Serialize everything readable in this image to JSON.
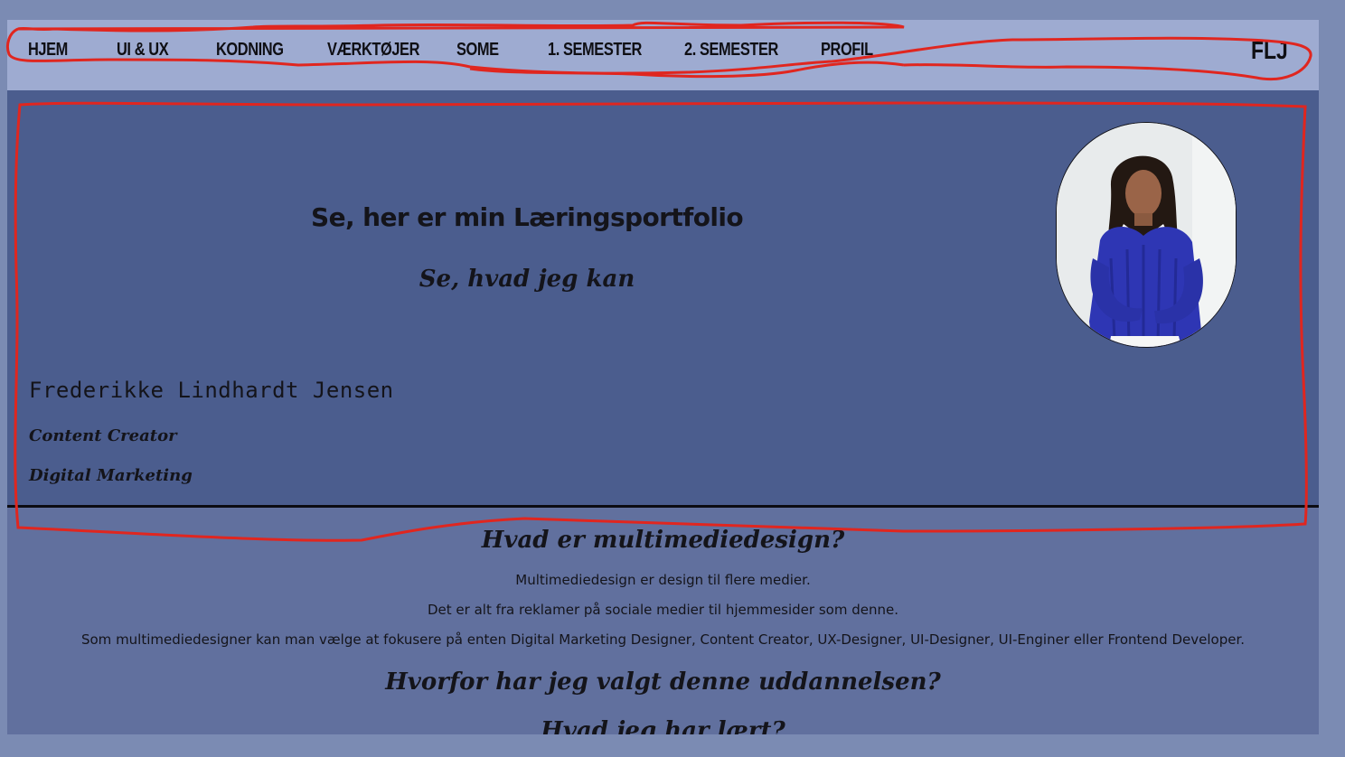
{
  "nav": {
    "items": [
      {
        "label": "HJEM"
      },
      {
        "label": "UI & UX"
      },
      {
        "label": "KODNING"
      },
      {
        "label": "VÆRKTØJER"
      },
      {
        "label": "SOME"
      },
      {
        "label": "1. SEMESTER"
      },
      {
        "label": "2. SEMESTER"
      },
      {
        "label": "PROFIL"
      }
    ],
    "logo": "FLJ"
  },
  "hero": {
    "title": "Se, her er min Læringsportfolio",
    "subtitle": "Se, hvad jeg kan",
    "name": "Frederikke Lindhardt Jensen",
    "roles": [
      "Content Creator",
      "Digital Marketing"
    ],
    "avatar_icon": "profile-photo"
  },
  "content": {
    "heading1": "Hvad er multimediedesign?",
    "paragraphs": [
      "Multimediedesign er design til flere medier.",
      "Det er alt fra reklamer på sociale medier til hjemmesider som denne.",
      "Som multimediedesigner kan man vælge at fokusere på enten Digital Marketing Designer, Content Creator, UX-Designer, UI-Designer, UI-Enginer eller Frontend Developer."
    ],
    "heading2": "Hvorfor har jeg valgt denne uddannelsen?",
    "heading3": "Hvad jeg har lært?"
  },
  "colors": {
    "background": "#7b8bb3",
    "navbar": "#9eabd1",
    "hero": "#4b5d8e",
    "content": "#61709e",
    "annotation": "#e0261f"
  }
}
